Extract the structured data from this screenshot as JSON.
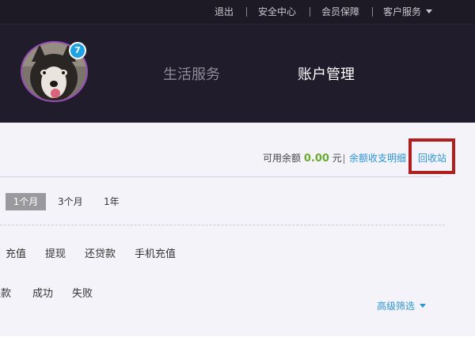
{
  "topbar": {
    "logout": "退出",
    "security_center": "安全中心",
    "member_protection": "会员保障",
    "customer_service": "客户服务"
  },
  "header": {
    "badge_count": "7",
    "nav_life_services": "生活服务",
    "nav_account_management": "账户管理"
  },
  "balance": {
    "label": "可用余额",
    "amount": "0.00",
    "unit": "元",
    "detail_link": "余额收支明细",
    "recycle_link": "回收站"
  },
  "periods": {
    "one_month": "1个月",
    "three_months": "3个月",
    "one_year": "1年"
  },
  "types": [
    "充值",
    "提现",
    "还贷款",
    "手机充值"
  ],
  "statuses": [
    "提款",
    "成功",
    "失败"
  ],
  "advanced_filter": "高级筛选",
  "colors": {
    "topbar_bg": "#1d1a25",
    "header_bg": "#211c2c",
    "content_bg": "#f4f3f9",
    "link": "#2a95d6",
    "amount": "#6aab2f",
    "badge": "#1fa1e8",
    "highlight_border": "#b01e1e"
  }
}
